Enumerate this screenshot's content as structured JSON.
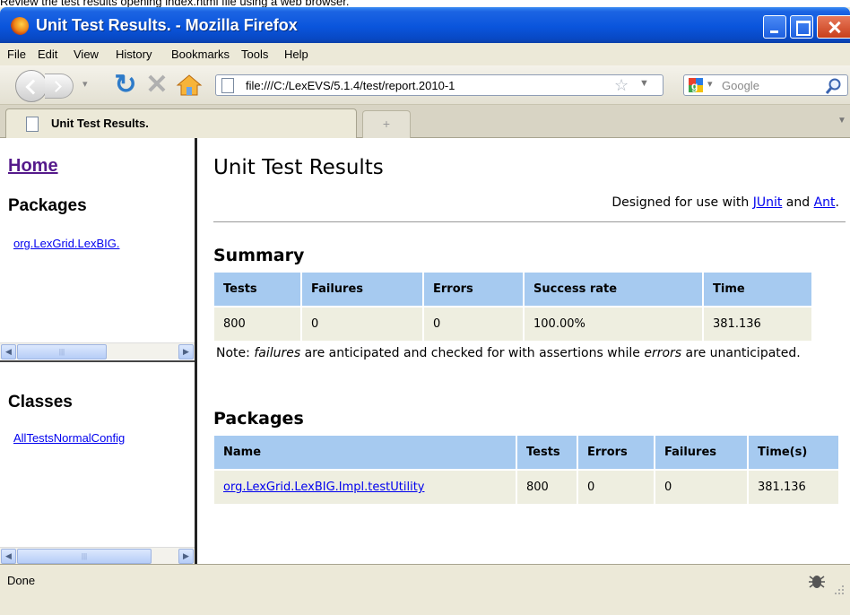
{
  "caption": "Review the test results opening index.html file using a web browser.",
  "window": {
    "title": "Unit Test Results. - Mozilla Firefox"
  },
  "menu": [
    "File",
    "Edit",
    "View",
    "History",
    "Bookmarks",
    "Tools",
    "Help"
  ],
  "nav": {
    "url": "file:///C:/LexEVS/5.1.4/test/report.2010-1",
    "search_placeholder": "Google"
  },
  "tab": {
    "label": "Unit Test Results.",
    "new_tab": "+"
  },
  "left": {
    "home": "Home",
    "packages_label": "Packages",
    "package_link": "org.LexGrid.LexBIG.",
    "classes_label": "Classes",
    "class_link": "AllTestsNormalConfig"
  },
  "main": {
    "title": "Unit Test Results",
    "designed_prefix": "Designed for use with ",
    "junit": "JUnit",
    "and": " and ",
    "ant": "Ant",
    "period": ".",
    "summary_heading": "Summary",
    "summary_headers": [
      "Tests",
      "Failures",
      "Errors",
      "Success rate",
      "Time"
    ],
    "summary_values": [
      "800",
      "0",
      "0",
      "100.00%",
      "381.136"
    ],
    "note_prefix": "Note: ",
    "note_failures": "failures",
    "note_middle": " are anticipated and checked for with assertions while ",
    "note_errors": "errors",
    "note_suffix": " are unanticipated.",
    "packages_heading": "Packages",
    "packages_headers": [
      "Name",
      "Tests",
      "Errors",
      "Failures",
      "Time(s)"
    ],
    "packages_row": [
      "org.LexGrid.LexBIG.Impl.testUtility",
      "800",
      "0",
      "0",
      "381.136"
    ]
  },
  "status": {
    "text": "Done"
  },
  "colors": {
    "title_bar": "#0a55dc",
    "table_header": "#a6caf0",
    "table_cell": "#eeeee0",
    "link": "#0000ee",
    "visited_link": "#551a8b"
  },
  "icons": [
    "firefox-icon",
    "minimize-icon",
    "maximize-icon",
    "close-icon",
    "back-icon",
    "forward-icon",
    "reload-icon",
    "stop-icon",
    "home-icon",
    "page-icon",
    "star-icon",
    "google-icon",
    "search-icon",
    "bug-icon"
  ]
}
